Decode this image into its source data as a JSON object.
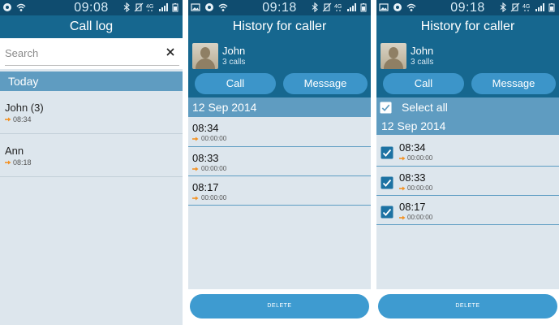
{
  "colors": {
    "status_bar": "#0f4c6f",
    "title_bar": "#16678f",
    "section_header": "#5f9cc1",
    "list_bg": "#dde6ed",
    "button": "#3c95c9",
    "delete_button": "#3e9bd0",
    "outgoing_arrow": "#f39224"
  },
  "icons": {
    "status_left": [
      "gallery-icon",
      "settings-gear-icon",
      "wifi-icon"
    ],
    "status_right": [
      "bluetooth-icon",
      "mute-icon",
      "4g-icon",
      "signal-icon",
      "battery-icon"
    ],
    "call_direction": "outgoing-arrow-icon",
    "clear": "close-icon",
    "checkbox": "checkbox-checked-icon"
  },
  "call_log": {
    "status_time": "09:08",
    "title": "Call log",
    "search_placeholder": "Search",
    "section": "Today",
    "entries": [
      {
        "name": "John (3)",
        "time": "08:34"
      },
      {
        "name": "Ann",
        "time": "08:18"
      }
    ]
  },
  "history": {
    "status_time": "09:18",
    "title": "History for caller",
    "caller_name": "John",
    "caller_calls": "3 calls",
    "call_button": "Call",
    "message_button": "Message",
    "date": "12 Sep 2014",
    "entries": [
      {
        "time": "08:34",
        "duration": "00:00:00"
      },
      {
        "time": "08:33",
        "duration": "00:00:00"
      },
      {
        "time": "08:17",
        "duration": "00:00:00"
      }
    ],
    "delete_button": "DELETE"
  },
  "history_select": {
    "status_time": "09:18",
    "title": "History for caller",
    "caller_name": "John",
    "caller_calls": "3 calls",
    "call_button": "Call",
    "message_button": "Message",
    "select_all": "Select all",
    "date": "12 Sep 2014",
    "entries": [
      {
        "time": "08:34",
        "duration": "00:00:00",
        "checked": true
      },
      {
        "time": "08:33",
        "duration": "00:00:00",
        "checked": true
      },
      {
        "time": "08:17",
        "duration": "00:00:00",
        "checked": true
      }
    ],
    "delete_button": "DELETE"
  }
}
